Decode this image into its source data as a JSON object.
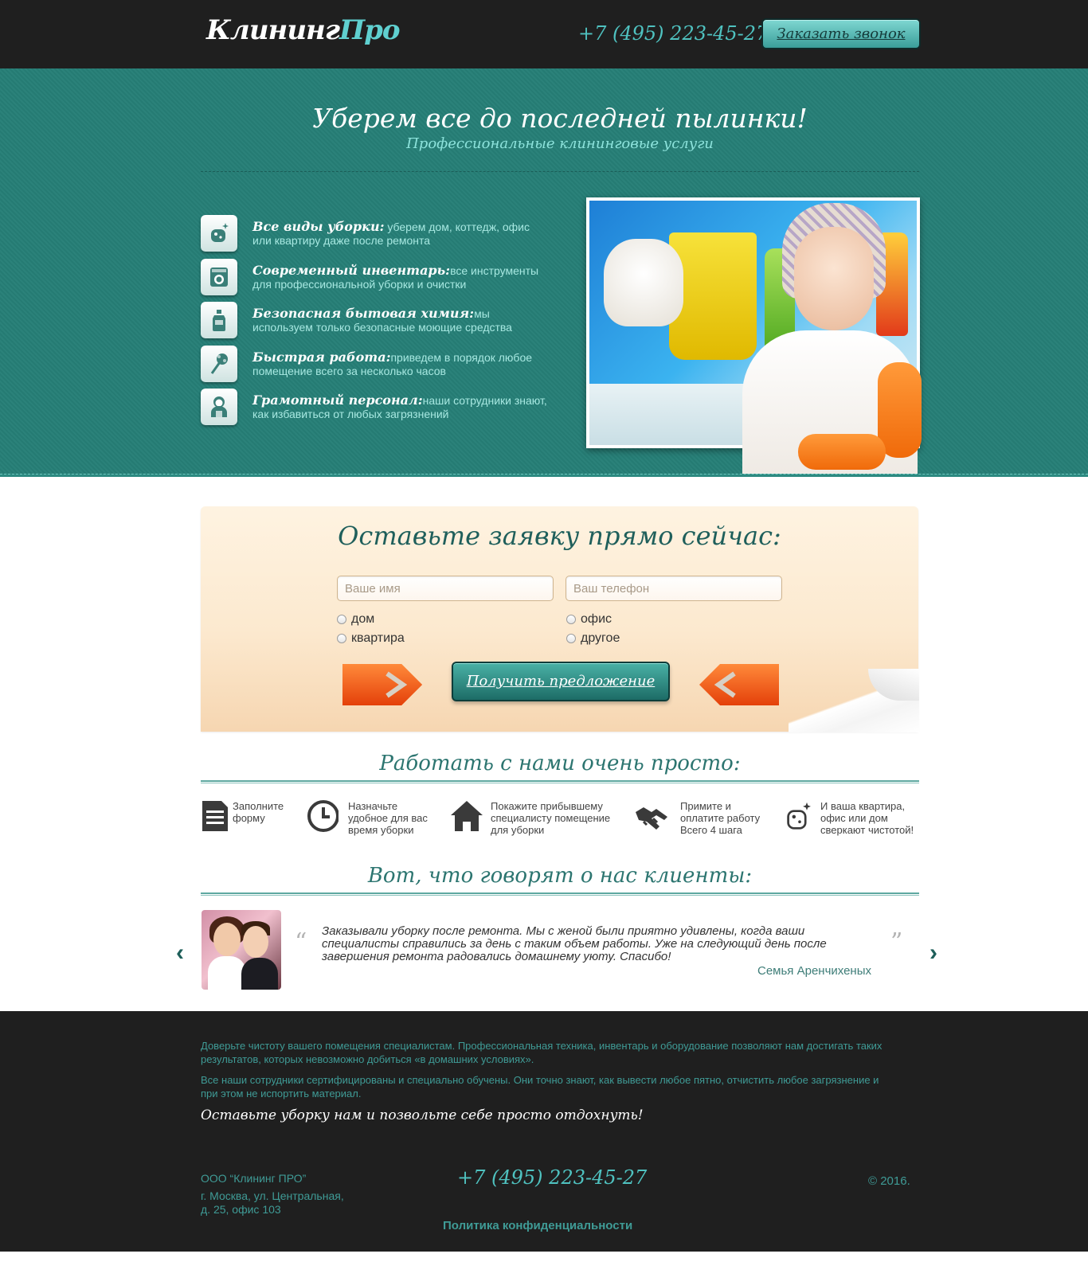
{
  "header": {
    "logo_main": "Клининг",
    "logo_accent": "Про",
    "phone": "+7 (495) 223-45-27",
    "callback_label": "Заказать звонок"
  },
  "hero": {
    "title": "Уберем все до последней пылинки!",
    "subtitle": "Профессиональные клининговые услуги",
    "features": [
      {
        "icon": "sponge-icon",
        "title": "Все виды уборки:",
        "text": " уберем дом, коттедж, офис или квартиру даже после ремонта"
      },
      {
        "icon": "washing-machine-icon",
        "title": "Современный инвентарь:",
        "text": "все инструменты для профессиональной уборки и очистки"
      },
      {
        "icon": "detergent-bottle-icon",
        "title": "Безопасная бытовая химия:",
        "text": "мы используем только безопасные моющие средства"
      },
      {
        "icon": "duster-icon",
        "title": "Быстрая работа:",
        "text": "приведем в порядок любое помещение всего за несколько часов"
      },
      {
        "icon": "staff-icon",
        "title": "Грамотный персонал:",
        "text": "наши сотрудники знают, как избавиться от любых загрязнений"
      }
    ]
  },
  "order": {
    "title": "Оставьте заявку прямо сейчас:",
    "name_placeholder": "Ваше имя",
    "phone_placeholder": "Ваш телефон",
    "options": [
      "дом",
      "офис",
      "квартира",
      "другое"
    ],
    "submit_label": "Получить предложение"
  },
  "steps": {
    "title": "Работать с нами очень просто:",
    "items": [
      {
        "icon": "form-icon",
        "text": "Заполните форму"
      },
      {
        "icon": "clock-icon",
        "text": "Назначьте удобное для вас время уборки"
      },
      {
        "icon": "house-icon",
        "text": "Покажите прибывшему специалисту помещение для уборки"
      },
      {
        "icon": "handshake-icon",
        "text": "Примите и оплатите работу Всего 4 шага"
      },
      {
        "icon": "sparkle-sponge-icon",
        "text": "И ваша квартира, офис или дом сверкают чистотой!"
      }
    ]
  },
  "reviews": {
    "title": "Вот, что говорят о нас клиенты:",
    "open_quote": "“",
    "close_quote": "”",
    "prev": "‹",
    "next": "›",
    "text": "Заказывали уборку после ремонта. Мы с женой были приятно удивлены, когда ваши специалисты справились за день с таким объем работы. Уже на следующий день после завершения ремонта радовались домашнему уюту. Спасибо!",
    "author": "Семья Аренчихеных"
  },
  "footer": {
    "p1": "Доверьте чистоту вашего помещения специалистам. Профессиональная техника, инвентарь и оборудование позволяют нам достигать таких результатов, которых невозможно добиться «в домашних условиях».",
    "p2": "Все наши сотрудники сертифицированы и специально обучены. Они точно знают, как вывести любое пятно, отчистить любое загрязнение и при этом не испортить материал.",
    "slogan": "Оставьте уборку нам и позвольте себе просто отдохнуть!",
    "company": "ООО “Клининг ПРО”",
    "address_line1": "г. Москва, ул. Центральная,",
    "address_line2": "д. 25, офис 103",
    "phone": "+7 (495) 223-45-27",
    "copyright": "© 2016.",
    "policy": "Политика конфиденциальности"
  },
  "colors": {
    "accent": "#267f77",
    "dark": "#1f1f1f",
    "teal_text": "#4fc2c0",
    "order_bg": "#fce9cf",
    "cta_orange": "#f06a0a"
  }
}
